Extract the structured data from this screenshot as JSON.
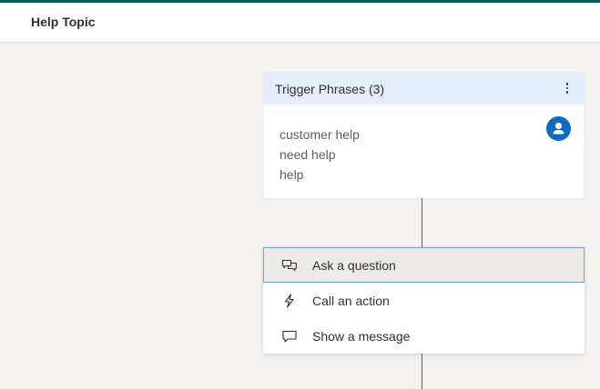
{
  "header": {
    "title": "Help Topic"
  },
  "trigger": {
    "title": "Trigger Phrases (3)",
    "phrases": [
      "customer help",
      "need help",
      "help"
    ]
  },
  "menu": {
    "items": [
      {
        "label": "Ask a question",
        "icon": "ask-question-icon",
        "selected": true
      },
      {
        "label": "Call an action",
        "icon": "lightning-icon",
        "selected": false
      },
      {
        "label": "Show a message",
        "icon": "message-icon",
        "selected": false
      }
    ]
  },
  "colors": {
    "accent_bar": "#0b5a57",
    "card_header": "#e6eefc",
    "avatar": "#0f6cbd",
    "selected_border": "#6f9ef5"
  }
}
